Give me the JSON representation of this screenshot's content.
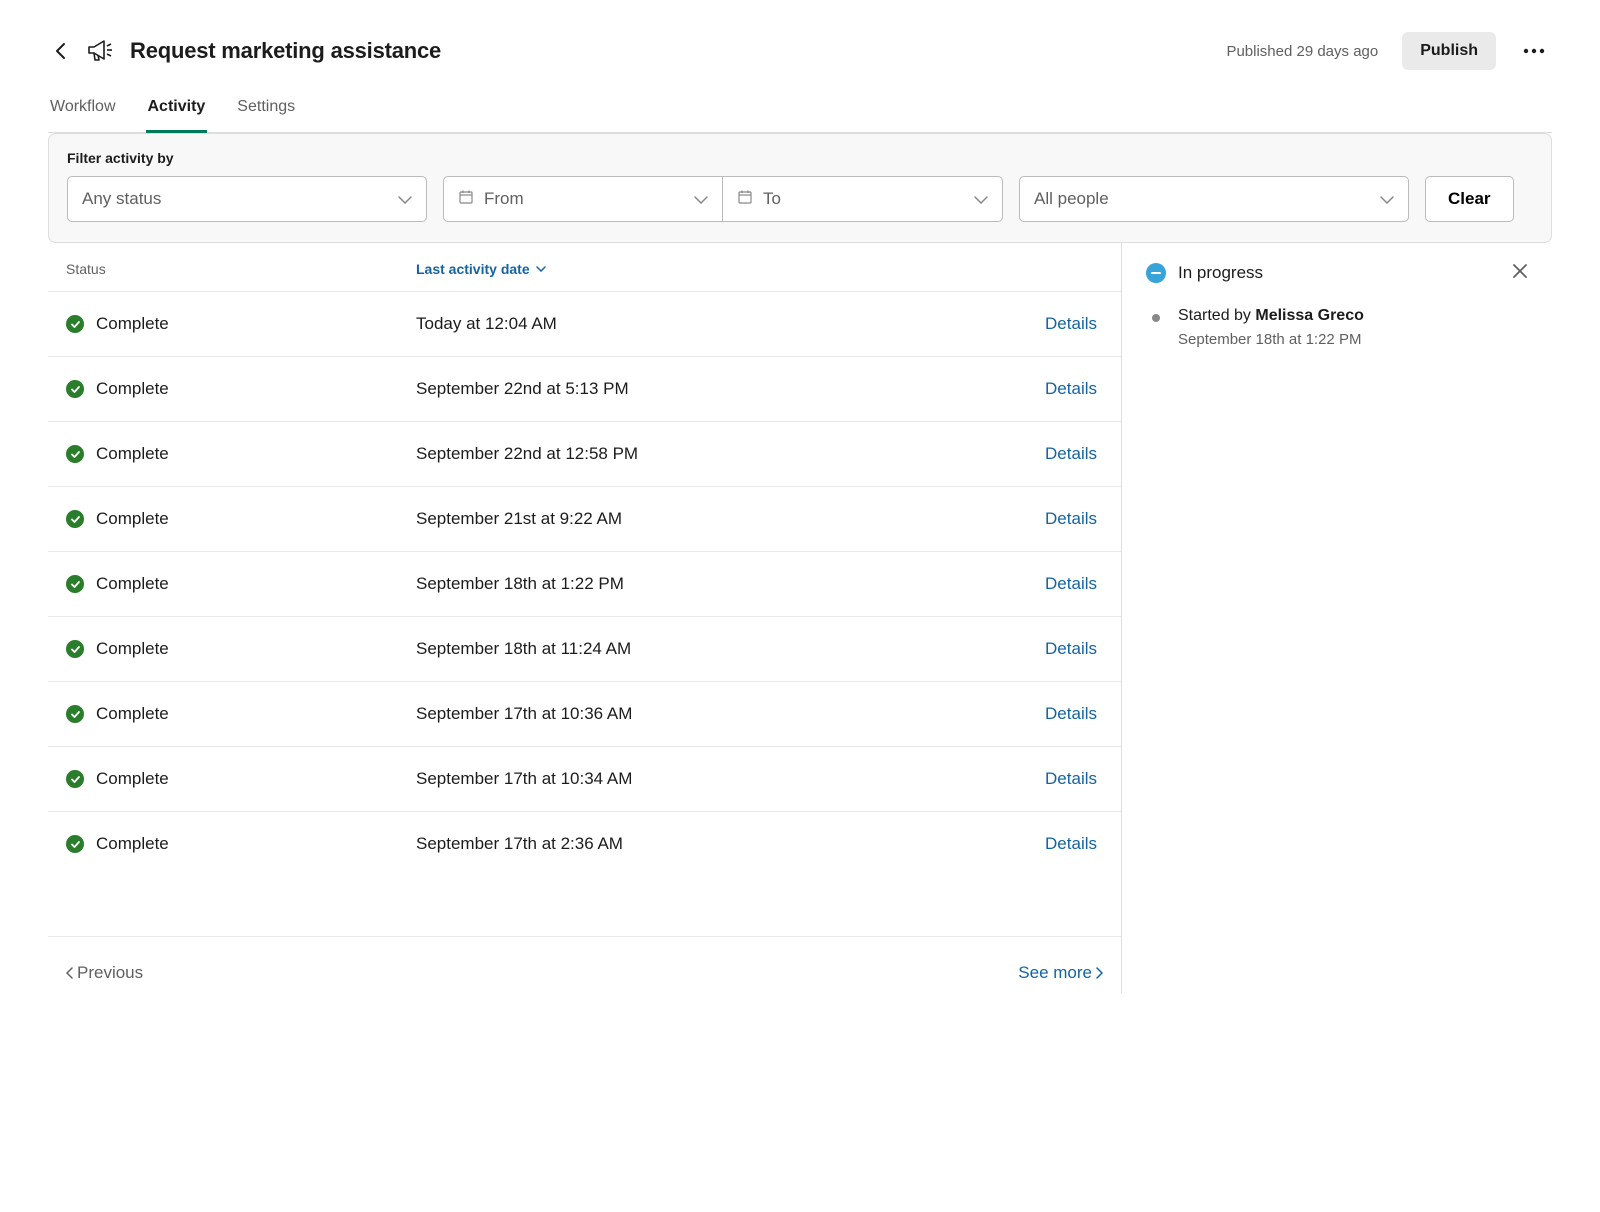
{
  "header": {
    "title": "Request marketing assistance",
    "published_text": "Published 29 days ago",
    "publish_button": "Publish"
  },
  "tabs": [
    {
      "label": "Workflow",
      "active": false
    },
    {
      "label": "Activity",
      "active": true
    },
    {
      "label": "Settings",
      "active": false
    }
  ],
  "filter": {
    "label": "Filter activity by",
    "status": "Any status",
    "from": "From",
    "to": "To",
    "people": "All people",
    "clear": "Clear"
  },
  "table": {
    "col_status": "Status",
    "col_date": "Last activity date",
    "details_label": "Details",
    "rows": [
      {
        "status": "Complete",
        "date": "Today at 12:04 AM"
      },
      {
        "status": "Complete",
        "date": "September 22nd at 5:13 PM"
      },
      {
        "status": "Complete",
        "date": "September 22nd at 12:58 PM"
      },
      {
        "status": "Complete",
        "date": "September 21st at 9:22 AM"
      },
      {
        "status": "Complete",
        "date": "September 18th at 1:22 PM"
      },
      {
        "status": "Complete",
        "date": "September 18th at 11:24 AM"
      },
      {
        "status": "Complete",
        "date": "September 17th at 10:36 AM"
      },
      {
        "status": "Complete",
        "date": "September 17th at 10:34 AM"
      },
      {
        "status": "Complete",
        "date": "September 17th at 2:36 AM"
      }
    ]
  },
  "pagination": {
    "previous": "Previous",
    "seemore": "See more"
  },
  "sidepanel": {
    "title": "In progress",
    "started_by_prefix": "Started by ",
    "started_by_name": "Melissa Greco",
    "timestamp": "September 18th at 1:22 PM"
  }
}
